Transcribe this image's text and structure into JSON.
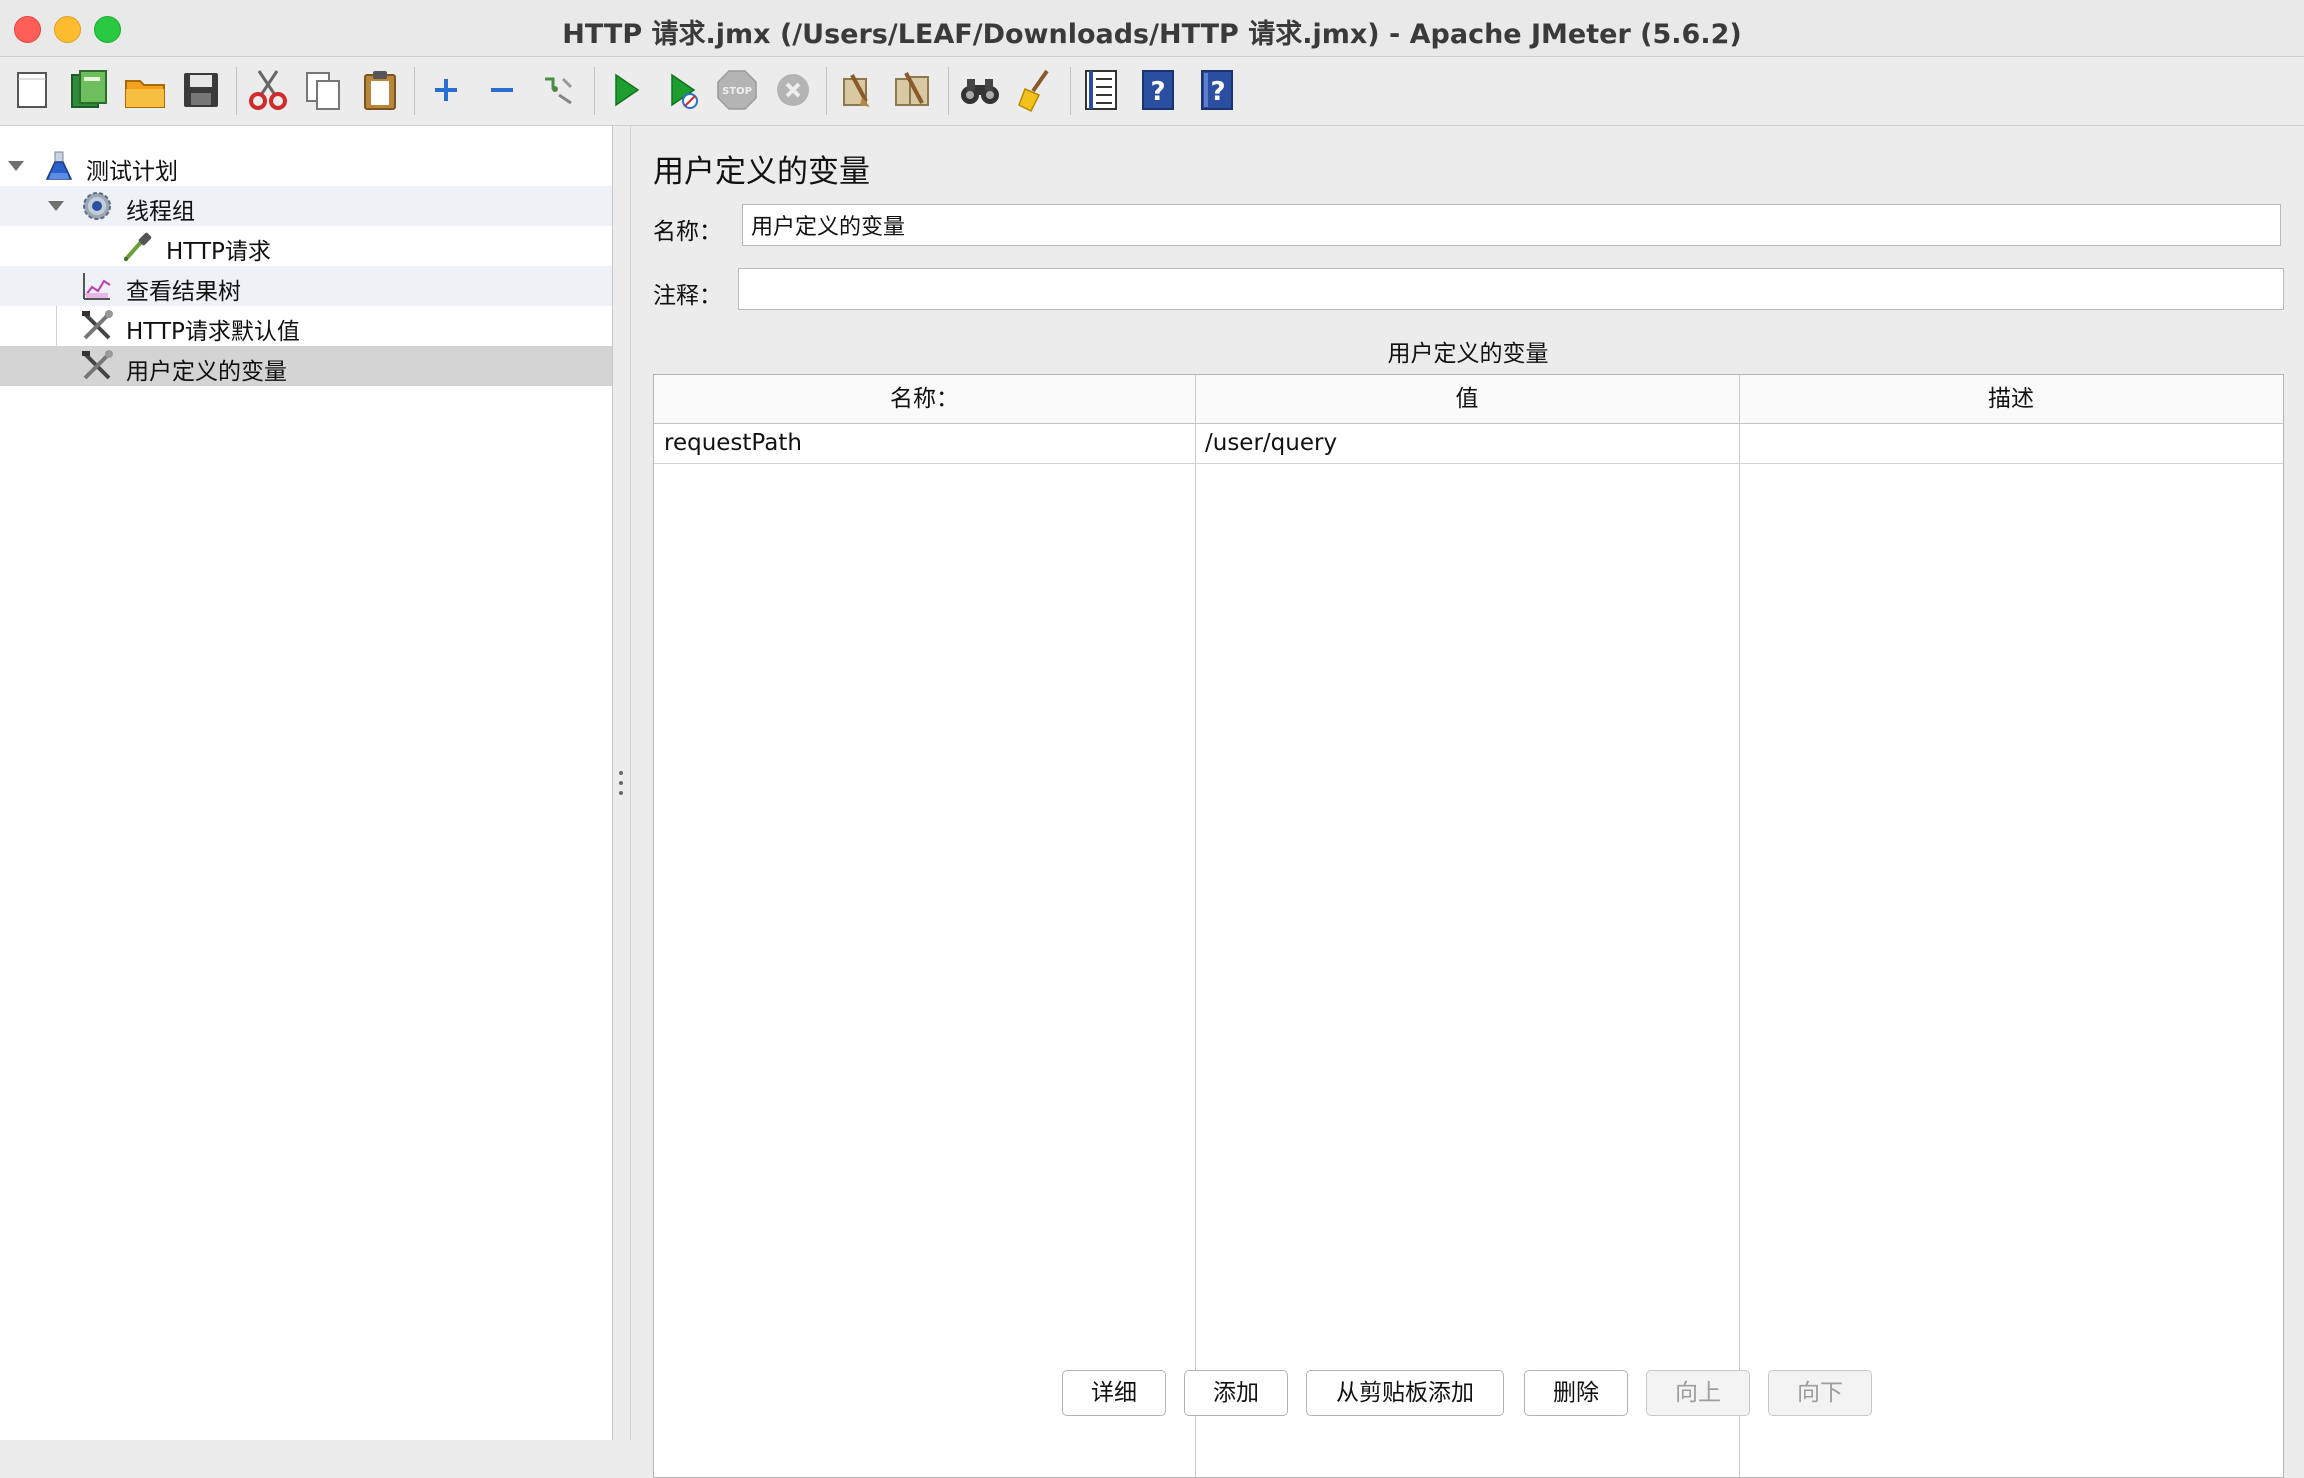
{
  "window": {
    "title": "HTTP 请求.jmx (/Users/LEAF/Downloads/HTTP 请求.jmx) - Apache JMeter (5.6.2)"
  },
  "toolbar": {
    "items": [
      "new-icon",
      "templates-icon",
      "open-icon",
      "save-icon",
      "cut-icon",
      "copy-icon",
      "paste-icon",
      "expand-icon",
      "collapse-icon",
      "toggle-icon",
      "start-icon",
      "start-no-pauses-icon",
      "stop-icon",
      "shutdown-icon",
      "clear-icon",
      "clear-all-icon",
      "search-icon",
      "reset-search-icon",
      "function-helper-icon",
      "help-icon",
      "about-icon"
    ]
  },
  "tree": {
    "nodes": [
      {
        "label": "测试计划",
        "icon": "flask-icon",
        "expanded": true
      },
      {
        "label": "线程组",
        "icon": "gear-icon",
        "expanded": true
      },
      {
        "label": "HTTP请求",
        "icon": "pipette-icon"
      },
      {
        "label": "查看结果树",
        "icon": "graph-icon"
      },
      {
        "label": "HTTP请求默认值",
        "icon": "tools-icon"
      },
      {
        "label": "用户定义的变量",
        "icon": "tools-icon",
        "selected": true
      }
    ]
  },
  "panel": {
    "title": "用户定义的变量",
    "name_label": "名称：",
    "name_value": "用户定义的变量",
    "comment_label": "注释：",
    "comment_value": "",
    "table_caption": "用户定义的变量",
    "columns": [
      "名称：",
      "值",
      "描述"
    ],
    "rows": [
      {
        "name": "requestPath",
        "value": "/user/query",
        "description": ""
      }
    ],
    "buttons": {
      "detail": "详细",
      "add": "添加",
      "add_clipboard": "从剪贴板添加",
      "delete": "删除",
      "up": "向上",
      "down": "向下"
    }
  },
  "colors": {
    "close": "#ff5f57",
    "minimize": "#febc2e",
    "maximize": "#28c840",
    "selection": "#d4d4d4",
    "start_green": "#1e9e2e"
  }
}
